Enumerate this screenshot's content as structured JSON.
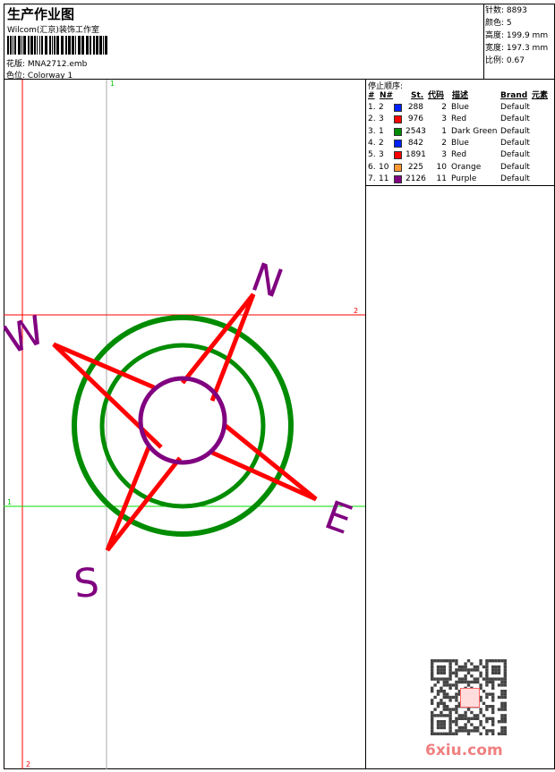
{
  "header": {
    "title": "生产作业图",
    "company": "Wilcom(汇京)装饰工作室",
    "design_label": "花版:",
    "design_file": "MNA2712.emb",
    "colorway_label": "色位:",
    "colorway": "Colorway 1"
  },
  "info": [
    {
      "label": "针数:",
      "value": "8893"
    },
    {
      "label": "颜色:",
      "value": "5"
    },
    {
      "label": "高度:",
      "value": "199.9 mm"
    },
    {
      "label": "宽度:",
      "value": "197.3 mm"
    },
    {
      "label": "比例:",
      "value": "0.67"
    }
  ],
  "stop_sequence": {
    "title": "停止顺序:",
    "headers": {
      "num": "#",
      "needle": "N#",
      "stitches": "St.",
      "code": "代码",
      "desc": "描述",
      "brand": "Brand",
      "element": "元素"
    },
    "rows": [
      {
        "num": "1.",
        "needle": "2",
        "color": "#0020ff",
        "stitches": "288",
        "code": "2",
        "desc": "Blue",
        "brand": "Default"
      },
      {
        "num": "2.",
        "needle": "3",
        "color": "#ff0000",
        "stitches": "976",
        "code": "3",
        "desc": "Red",
        "brand": "Default"
      },
      {
        "num": "3.",
        "needle": "1",
        "color": "#008c00",
        "stitches": "2543",
        "code": "1",
        "desc": "Dark Green",
        "brand": "Default"
      },
      {
        "num": "4.",
        "needle": "2",
        "color": "#0020ff",
        "stitches": "842",
        "code": "2",
        "desc": "Blue",
        "brand": "Default"
      },
      {
        "num": "5.",
        "needle": "3",
        "color": "#ff0000",
        "stitches": "1891",
        "code": "3",
        "desc": "Red",
        "brand": "Default"
      },
      {
        "num": "6.",
        "needle": "10",
        "color": "#ff9933",
        "stitches": "225",
        "code": "10",
        "desc": "Orange",
        "brand": "Default"
      },
      {
        "num": "7.",
        "needle": "11",
        "color": "#800080",
        "stitches": "2126",
        "code": "11",
        "desc": "Purple",
        "brand": "Default"
      }
    ]
  },
  "guides": {
    "top_label": "1",
    "bottom_label": "2",
    "right_label": "2",
    "left_label": "1"
  },
  "design": {
    "letters": {
      "n": "N",
      "e": "E",
      "s": "S",
      "w": "W"
    }
  },
  "watermark": {
    "text": "6xiu.com",
    "stamp": "以图制版"
  }
}
